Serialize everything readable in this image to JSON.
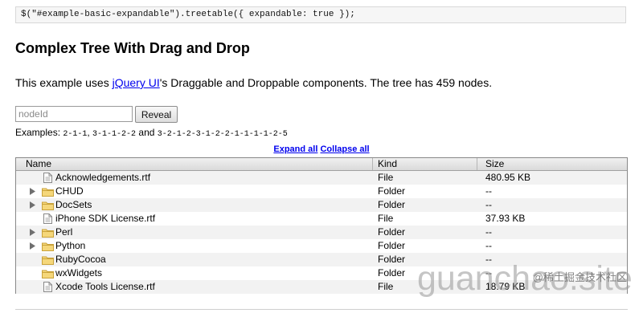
{
  "code_line": "$(\"#example-basic-expandable\").treetable({ expandable: true });",
  "heading": "Complex Tree With Drag and Drop",
  "intro": {
    "before": "This example uses ",
    "link": "jQuery UI",
    "after": "'s Draggable and Droppable components. The tree has 459 nodes."
  },
  "reveal": {
    "placeholder": "nodeId",
    "value": "",
    "button_label": "Reveal"
  },
  "examples": {
    "prefix": "Examples: ",
    "first": "2-1-1",
    "sep1": ", ",
    "second": "3-1-1-2-2",
    "sep2": " and ",
    "third": "3-2-1-2-3-1-2-2-1-1-1-1-2-5"
  },
  "toggles": {
    "expand": "Expand all",
    "collapse": "Collapse all"
  },
  "table": {
    "headers": {
      "name": "Name",
      "kind": "Kind",
      "size": "Size"
    },
    "rows": [
      {
        "name": "Acknowledgements.rtf",
        "kind": "File",
        "size": "480.95 KB",
        "icon": "file-icon",
        "expandable": false
      },
      {
        "name": "CHUD",
        "kind": "Folder",
        "size": "--",
        "icon": "folder-icon",
        "expandable": true
      },
      {
        "name": "DocSets",
        "kind": "Folder",
        "size": "--",
        "icon": "folder-icon",
        "expandable": true
      },
      {
        "name": "iPhone SDK License.rtf",
        "kind": "File",
        "size": "37.93 KB",
        "icon": "file-icon",
        "expandable": false
      },
      {
        "name": "Perl",
        "kind": "Folder",
        "size": "--",
        "icon": "folder-icon",
        "expandable": true
      },
      {
        "name": "Python",
        "kind": "Folder",
        "size": "--",
        "icon": "folder-icon",
        "expandable": true
      },
      {
        "name": "RubyCocoa",
        "kind": "Folder",
        "size": "--",
        "icon": "folder-icon",
        "expandable": false
      },
      {
        "name": "wxWidgets",
        "kind": "Folder",
        "size": "--",
        "icon": "folder-icon",
        "expandable": false
      },
      {
        "name": "Xcode Tools License.rtf",
        "kind": "File",
        "size": "18.79 KB",
        "icon": "file-icon",
        "expandable": false
      }
    ]
  },
  "watermark": {
    "main": "guanchao.site",
    "credit": "@稀土掘金技术社区"
  },
  "colors": {
    "link": "#0000ee",
    "folder": "#f5d77a",
    "row_alt": "#f2f2f2"
  }
}
